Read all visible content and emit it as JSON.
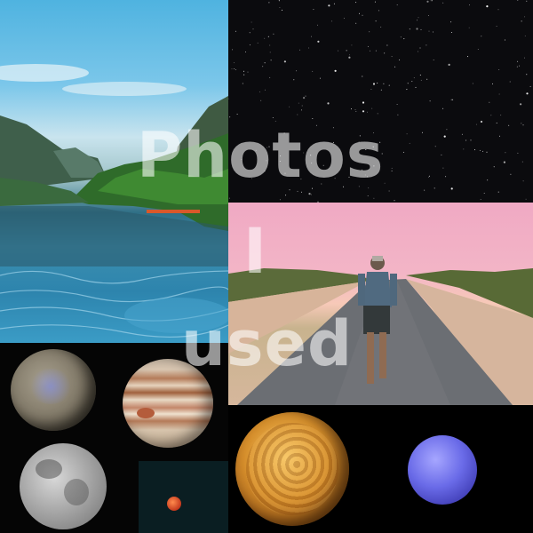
{
  "overlay": {
    "lines": [
      "Photos",
      "I",
      "used"
    ]
  },
  "tiles": {
    "lake": "lake-landscape-photo",
    "stars": "starry-sky-photo",
    "road": "person-walking-on-road-photo",
    "planets": [
      "ceres",
      "jupiter",
      "moon",
      "mars",
      "venus",
      "neptune"
    ]
  }
}
